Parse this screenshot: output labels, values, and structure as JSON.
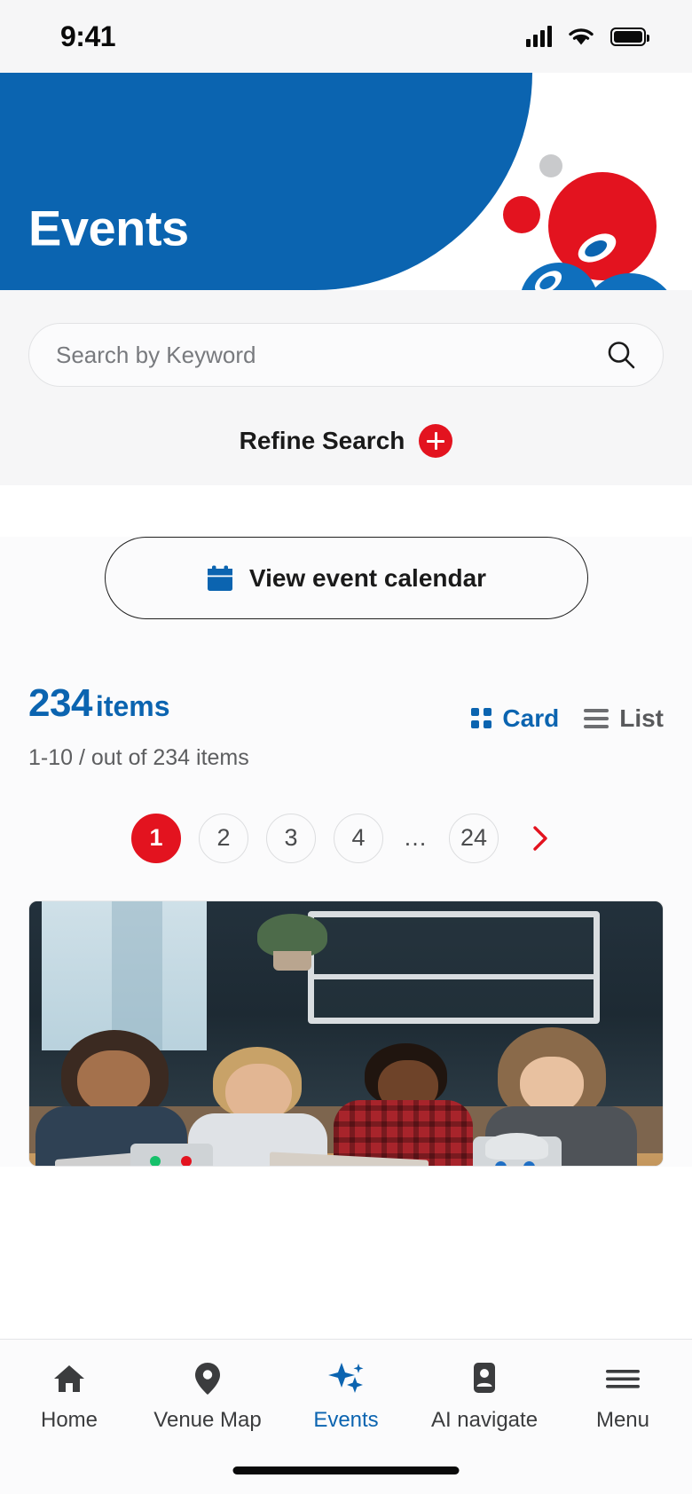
{
  "status_bar": {
    "time": "9:41",
    "signal_icon": "cellular-signal-icon",
    "wifi_icon": "wifi-icon",
    "battery_icon": "battery-full-icon"
  },
  "hero": {
    "title": "Events",
    "background_color": "#0b64b0",
    "accent_red": "#e3131f",
    "accent_gray": "#cfd0d2"
  },
  "search": {
    "placeholder": "Search by Keyword",
    "value": "",
    "icon": "search-icon",
    "refine_label": "Refine Search",
    "refine_icon": "plus-icon"
  },
  "calendar_button": {
    "label": "View event calendar",
    "icon": "calendar-icon"
  },
  "results": {
    "count": "234",
    "count_unit": "items",
    "range_text": "1-10 / out of 234 items",
    "view_modes": [
      {
        "label": "Card",
        "icon": "grid-icon",
        "active": true
      },
      {
        "label": "List",
        "icon": "list-icon",
        "active": false
      }
    ]
  },
  "pagination": {
    "pages": [
      "1",
      "2",
      "3",
      "4",
      "…",
      "24"
    ],
    "current": "1",
    "next_icon": "chevron-right-icon",
    "next_color": "#e3131f"
  },
  "card": {
    "image_alt": "Four children smiling around a table with laptops and robot kits",
    "image_icon": "event-photo"
  },
  "bottom_nav": {
    "items": [
      {
        "label": "Home",
        "icon": "home-icon",
        "active": false
      },
      {
        "label": "Venue Map",
        "icon": "map-pin-icon",
        "active": false
      },
      {
        "label": "Events",
        "icon": "sparkle-star-icon",
        "active": true
      },
      {
        "label": "AI navigate",
        "icon": "ai-badge-icon",
        "active": false
      },
      {
        "label": "Menu",
        "icon": "hamburger-menu-icon",
        "active": false
      }
    ]
  },
  "colors": {
    "brand_blue": "#0b64b0",
    "brand_red": "#e3131f",
    "page_background": "#fbfbfc",
    "panel_background": "#f6f6f7"
  }
}
